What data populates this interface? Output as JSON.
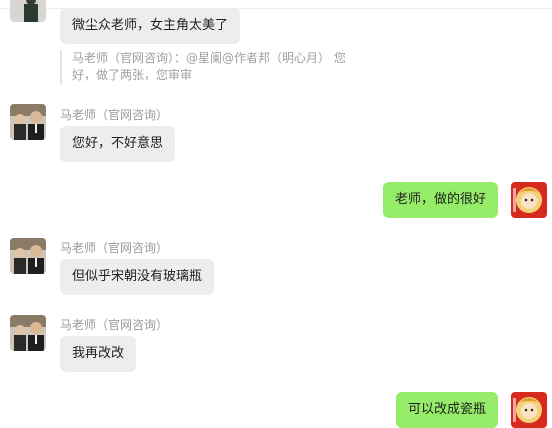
{
  "chat": {
    "messages": [
      {
        "id": "m1",
        "direction": "in",
        "sender": "",
        "text": "微尘众老师，女主角太美了"
      },
      {
        "id": "m2",
        "direction": "in",
        "sender": "马老师（官网咨询）",
        "text": "您好，不好意思"
      },
      {
        "id": "m3",
        "direction": "out",
        "text": "老师，做的很好"
      },
      {
        "id": "m4",
        "direction": "in",
        "sender": "马老师（官网咨询）",
        "text": "但似乎宋朝没有玻璃瓶"
      },
      {
        "id": "m5",
        "direction": "in",
        "sender": "马老师（官网咨询）",
        "text": "我再改改"
      },
      {
        "id": "m6",
        "direction": "out",
        "text": "可以改成瓷瓶"
      }
    ],
    "quote": {
      "line1": "马老师（官网咨询）：@星阑@作者邦（明心月） 您",
      "line2": "好，做了两张，您审审"
    }
  },
  "colors": {
    "incoming_bubble": "#ededed",
    "outgoing_bubble": "#95ec69",
    "sender_text": "#9a9a9a",
    "quote_text": "#a0a0a0"
  }
}
